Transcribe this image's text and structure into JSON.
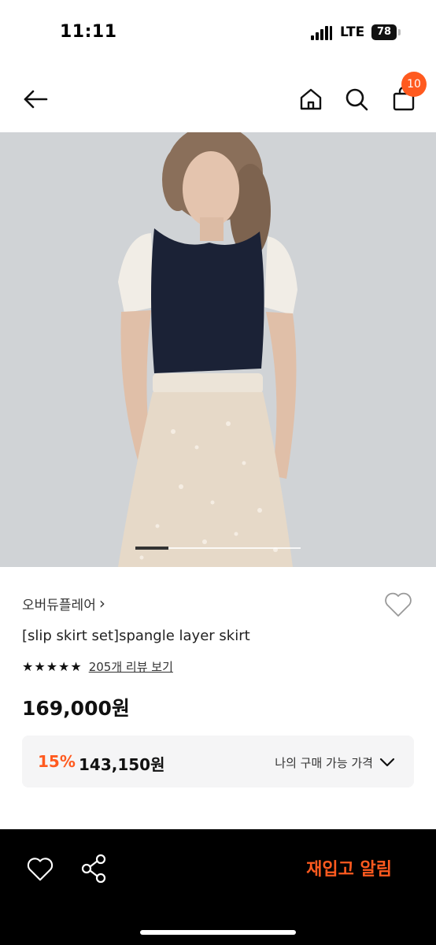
{
  "status_bar": {
    "time": "11:11",
    "network": "LTE",
    "battery": "78"
  },
  "header": {
    "back_icon": "arrow-left-icon",
    "home_icon": "home-icon",
    "search_icon": "search-icon",
    "cart_icon": "shopping-bag-icon",
    "cart_count": "10"
  },
  "hero": {
    "slide_progress": 0.2
  },
  "product": {
    "brand": "오버듀플레어",
    "brand_chevron": "›",
    "title": "[slip skirt set]spangle layer skirt",
    "stars": "★★★★★",
    "review_link": "205개 리뷰 보기",
    "price": "169,000원",
    "discount": {
      "rate": "15%",
      "price": "143,150원",
      "label": "나의 구매 가능 가격"
    }
  },
  "bottom_bar": {
    "restock_label": "재입고 알림"
  },
  "colors": {
    "accent": "#ff5a1f",
    "bottom_bar_bg": "#000000"
  }
}
